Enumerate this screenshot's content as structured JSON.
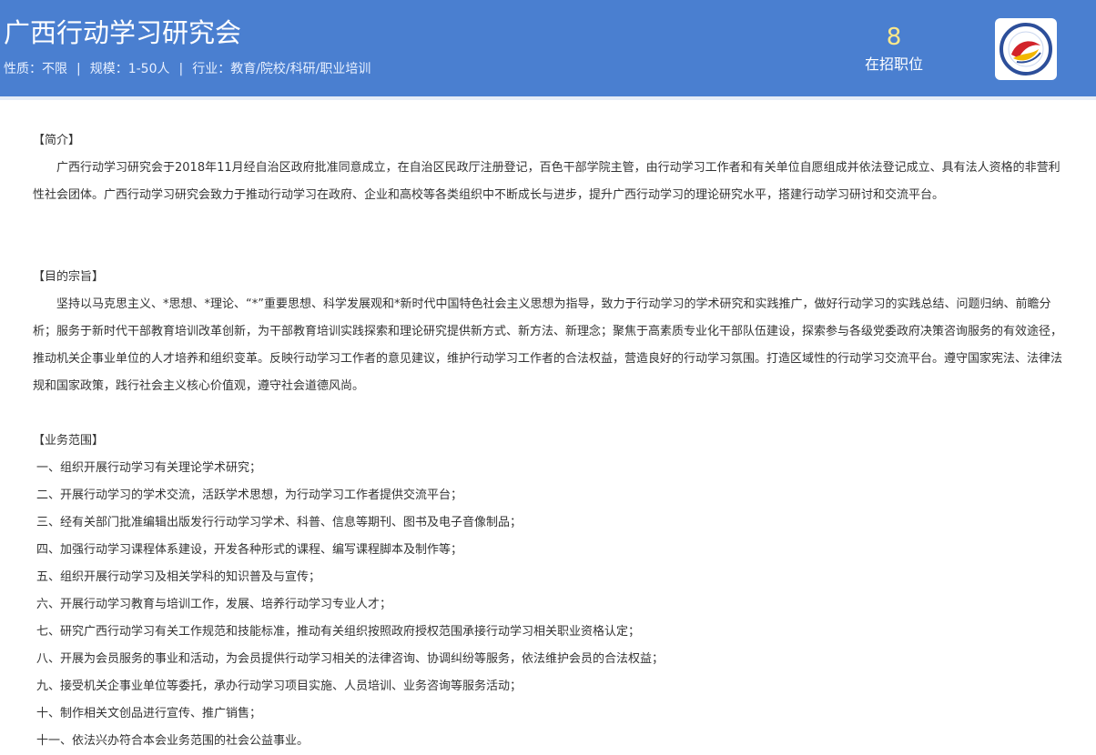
{
  "header": {
    "org_name": "广西行动学习研究会",
    "meta": {
      "nature": "性质：不限",
      "scale": "规模：1-50人",
      "industry": "行业：教育/院校/科研/职业培训",
      "separator": "|"
    },
    "jobs_count": "8",
    "jobs_label": "在招职位",
    "logo_icon": "org-logo-icon"
  },
  "sections": {
    "intro": {
      "title": "【简介】",
      "text": "广西行动学习研究会于2018年11月经自治区政府批准同意成立，在自治区民政厅注册登记，百色干部学院主管，由行动学习工作者和有关单位自愿组成并依法登记成立、具有法人资格的非营利性社会团体。广西行动学习研究会致力于推动行动学习在政府、企业和高校等各类组织中不断成长与进步，提升广西行动学习的理论研究水平，搭建行动学习研讨和交流平台。"
    },
    "purpose": {
      "title": "【目的宗旨】",
      "text": "坚持以马克思主义、*思想、*理论、“*”重要思想、科学发展观和*新时代中国特色社会主义思想为指导，致力于行动学习的学术研究和实践推广，做好行动学习的实践总结、问题归纳、前瞻分析；服务于新时代干部教育培训改革创新，为干部教育培训实践探索和理论研究提供新方式、新方法、新理念；聚焦于高素质专业化干部队伍建设，探索参与各级党委政府决策咨询服务的有效途径，推动机关企事业单位的人才培养和组织变革。反映行动学习工作者的意见建议，维护行动学习工作者的合法权益，营造良好的行动学习氛围。打造区域性的行动学习交流平台。遵守国家宪法、法律法规和国家政策，践行社会主义核心价值观，遵守社会道德风尚。"
    },
    "scope": {
      "title": "【业务范围】",
      "items": [
        "一、组织开展行动学习有关理论学术研究；",
        "二、开展行动学习的学术交流，活跃学术思想，为行动学习工作者提供交流平台；",
        "三、经有关部门批准编辑出版发行行动学习学术、科普、信息等期刊、图书及电子音像制品；",
        "四、加强行动学习课程体系建设，开发各种形式的课程、编写课程脚本及制作等；",
        "五、组织开展行动学习及相关学科的知识普及与宣传；",
        "六、开展行动学习教育与培训工作，发展、培养行动学习专业人才；",
        "七、研究广西行动学习有关工作规范和技能标准，推动有关组织按照政府授权范围承接行动学习相关职业资格认定；",
        "八、开展为会员服务的事业和活动，为会员提供行动学习相关的法律咨询、协调纠纷等服务，依法维护会员的合法权益；",
        "九、接受机关企事业单位等委托，承办行动学习项目实施、人员培训、业务咨询等服务活动；",
        "十、制作相关文创品进行宣传、推广销售；",
        "十一、依法兴办符合本会业务范围的社会公益事业。"
      ]
    }
  },
  "colors": {
    "header_bg": "#4a7fd0",
    "jobs_count": "#ffe98a",
    "body_text": "#333333"
  }
}
